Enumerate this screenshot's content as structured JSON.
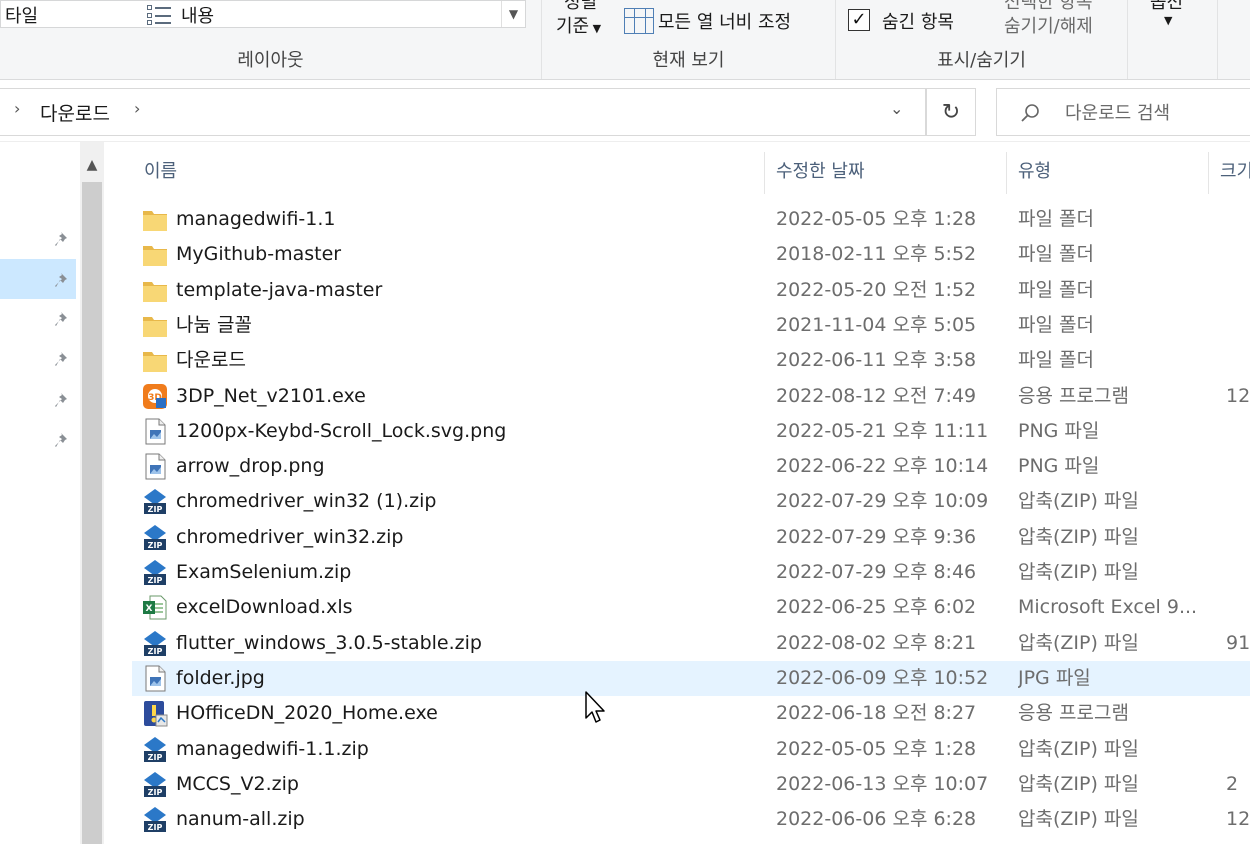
{
  "ribbon": {
    "layout_tile": "타일",
    "layout_content": "내용",
    "layout_group": "레이아웃",
    "sort_top": "정렬",
    "sort_label": "기준",
    "fit_columns": "모든 열 너비 조정",
    "view_group": "현재 보기",
    "hidden_items": "숨긴 항목",
    "hide_selected_top": "선택한 항목",
    "hide_selected_bottom": "숨기기/해제",
    "show_hide_group": "표시/숨기기",
    "options": "옵션"
  },
  "address": {
    "path": "다운로드",
    "search_placeholder": "다운로드 검색"
  },
  "columns": {
    "name": "이름",
    "date": "수정한 날짜",
    "type": "유형",
    "size": "크기"
  },
  "files": [
    {
      "name": "managedwifi-1.1",
      "date": "2022-05-05 오후 1:28",
      "type": "파일 폴더",
      "size": "",
      "icon": "folder-icon"
    },
    {
      "name": "MyGithub-master",
      "date": "2018-02-11 오후 5:52",
      "type": "파일 폴더",
      "size": "",
      "icon": "folder-icon"
    },
    {
      "name": "template-java-master",
      "date": "2022-05-20 오전 1:52",
      "type": "파일 폴더",
      "size": "",
      "icon": "folder-icon"
    },
    {
      "name": "나눔 글꼴",
      "date": "2021-11-04 오후 5:05",
      "type": "파일 폴더",
      "size": "",
      "icon": "folder-icon"
    },
    {
      "name": "다운로드",
      "date": "2022-06-11 오후 3:58",
      "type": "파일 폴더",
      "size": "",
      "icon": "folder-icon"
    },
    {
      "name": "3DP_Net_v2101.exe",
      "date": "2022-08-12 오전 7:49",
      "type": "응용 프로그램",
      "size": "12",
      "icon": "exe-3dp-icon"
    },
    {
      "name": "1200px-Keybd-Scroll_Lock.svg.png",
      "date": "2022-05-21 오후 11:11",
      "type": "PNG 파일",
      "size": "",
      "icon": "image-file-icon"
    },
    {
      "name": "arrow_drop.png",
      "date": "2022-06-22 오후 10:14",
      "type": "PNG 파일",
      "size": "",
      "icon": "image-file-icon"
    },
    {
      "name": "chromedriver_win32 (1).zip",
      "date": "2022-07-29 오후 10:09",
      "type": "압축(ZIP) 파일",
      "size": "",
      "icon": "zip-icon"
    },
    {
      "name": "chromedriver_win32.zip",
      "date": "2022-07-29 오후 9:36",
      "type": "압축(ZIP) 파일",
      "size": "",
      "icon": "zip-icon"
    },
    {
      "name": "ExamSelenium.zip",
      "date": "2022-07-29 오후 8:46",
      "type": "압축(ZIP) 파일",
      "size": "",
      "icon": "zip-icon"
    },
    {
      "name": "excelDownload.xls",
      "date": "2022-06-25 오후 6:02",
      "type": "Microsoft Excel 9...",
      "size": "",
      "icon": "excel-icon"
    },
    {
      "name": "flutter_windows_3.0.5-stable.zip",
      "date": "2022-08-02 오후 8:21",
      "type": "압축(ZIP) 파일",
      "size": "91",
      "icon": "zip-icon"
    },
    {
      "name": "folder.jpg",
      "date": "2022-06-09 오후 10:52",
      "type": "JPG 파일",
      "size": "",
      "icon": "image-file-icon"
    },
    {
      "name": "HOfficeDN_2020_Home.exe",
      "date": "2022-06-18 오전 8:27",
      "type": "응용 프로그램",
      "size": "",
      "icon": "installer-icon"
    },
    {
      "name": "managedwifi-1.1.zip",
      "date": "2022-05-05 오후 1:28",
      "type": "압축(ZIP) 파일",
      "size": "",
      "icon": "zip-icon"
    },
    {
      "name": "MCCS_V2.zip",
      "date": "2022-06-13 오후 10:07",
      "type": "압축(ZIP) 파일",
      "size": "2",
      "icon": "zip-icon"
    },
    {
      "name": "nanum-all.zip",
      "date": "2022-06-06 오후 6:28",
      "type": "압축(ZIP) 파일",
      "size": "12",
      "icon": "zip-icon"
    }
  ],
  "hovered_file": "folder.jpg",
  "colors": {
    "hover_row": "#e5f3ff",
    "nav_selected": "#cce8ff",
    "folder": "#f8d775",
    "header_text": "#4c607a"
  }
}
